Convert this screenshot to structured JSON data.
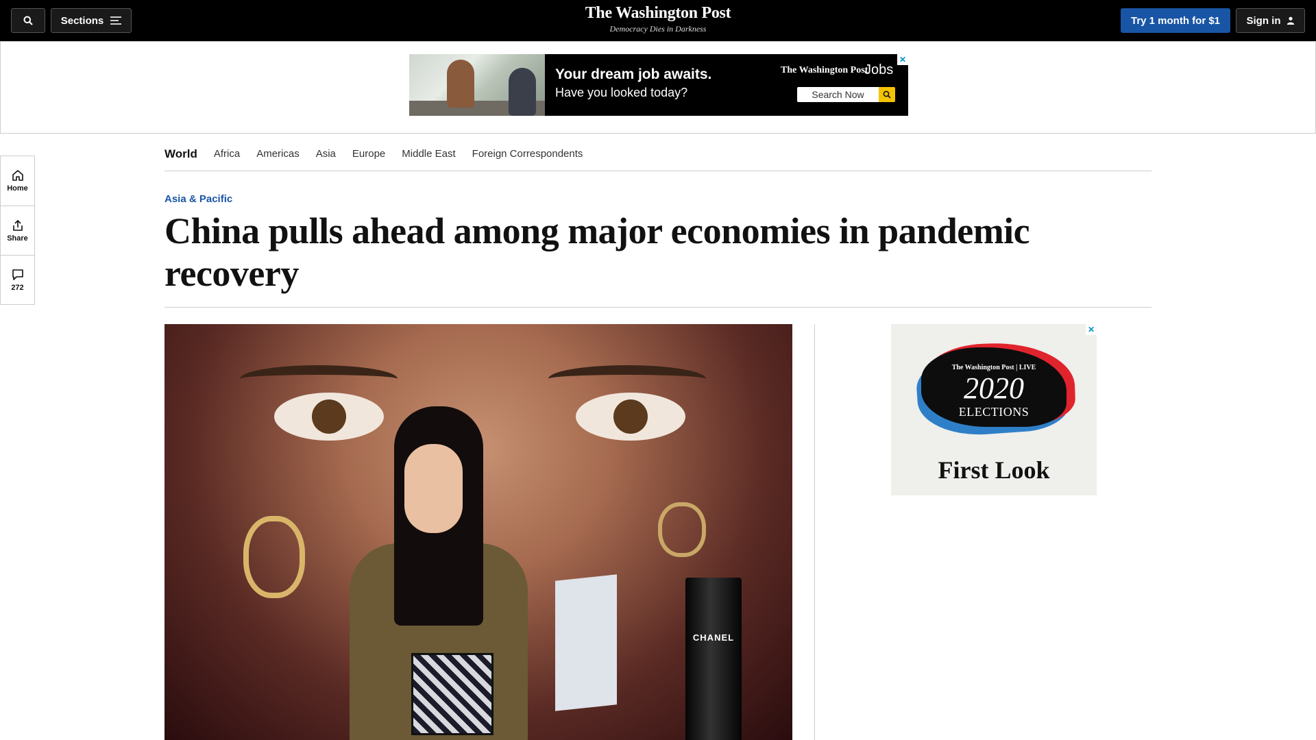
{
  "header": {
    "sections_label": "Sections",
    "logo": "The Washington Post",
    "tagline": "Democracy Dies in Darkness",
    "trial_label": "Try 1 month for $1",
    "signin_label": "Sign in",
    "colors": {
      "bar": "#000000",
      "trial_button": "#1955a5"
    }
  },
  "jobs_ad": {
    "headline": "Your dream job awaits.",
    "subline": "Have you looked today?",
    "brand": "The Washington Post",
    "brand_suffix": "Jobs",
    "search_label": "Search Now"
  },
  "left_rail": [
    {
      "label": "Home",
      "icon": "home-icon"
    },
    {
      "label": "Share",
      "icon": "share-icon"
    },
    {
      "label": "272",
      "icon": "comment-icon"
    }
  ],
  "section_nav": {
    "current": "World",
    "links": [
      "Africa",
      "Americas",
      "Asia",
      "Europe",
      "Middle East",
      "Foreign Correspondents"
    ]
  },
  "article": {
    "kicker": "Asia & Pacific",
    "headline": "China pulls ahead among major economies in pandemic recovery",
    "image_brand_text": "CHANEL"
  },
  "election_ad": {
    "brand": "The Washington Post | LIVE",
    "year": "2020",
    "word": "ELECTIONS",
    "cta": "First Look"
  },
  "ad_close_glyph": "✕"
}
